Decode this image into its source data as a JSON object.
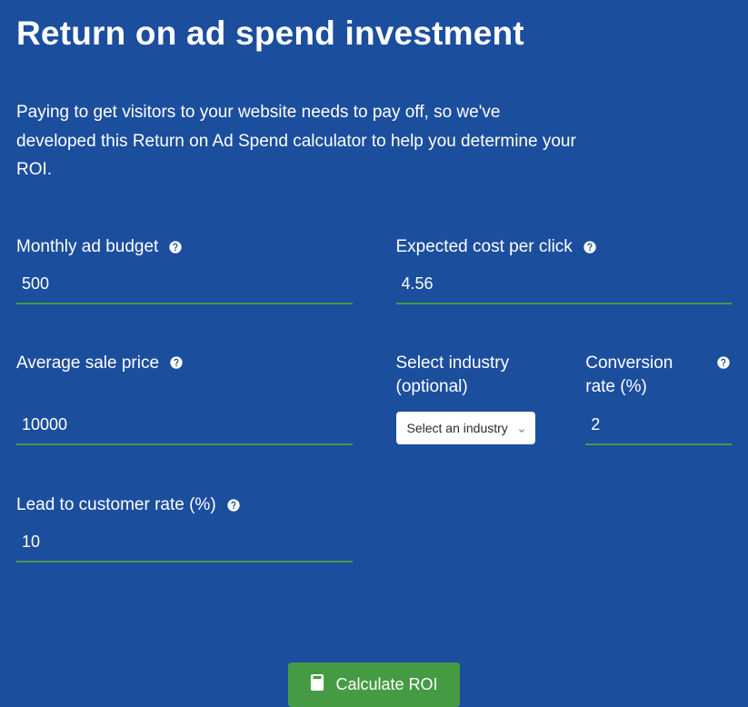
{
  "title": "Return on ad spend investment",
  "intro": "Paying to get visitors to your website needs to pay off, so we've developed this Return on Ad Spend calculator to help you determine your ROI.",
  "fields": {
    "monthly_ad_budget": {
      "label": "Monthly ad budget",
      "value": "500"
    },
    "cost_per_click": {
      "label": "Expected cost per click",
      "value": "4.56"
    },
    "avg_sale_price": {
      "label": "Average sale price",
      "value": "10000"
    },
    "industry": {
      "label": "Select industry (optional)",
      "placeholder": "Select an industry"
    },
    "conversion_rate": {
      "label": "Conversion rate (%)",
      "value": "2"
    },
    "lead_to_customer": {
      "label": "Lead to customer rate (%)",
      "value": "10"
    }
  },
  "cta": {
    "label": "Calculate ROI"
  }
}
